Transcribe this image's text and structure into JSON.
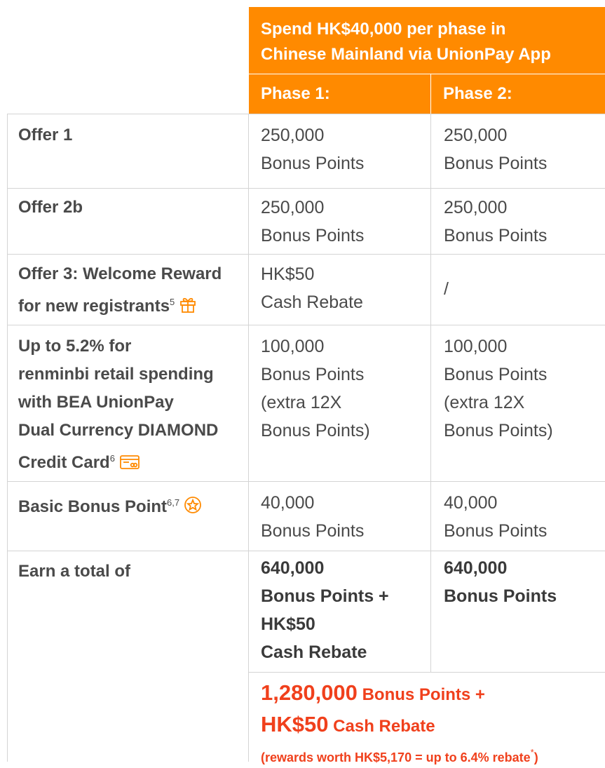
{
  "header": {
    "line1": "Spend HK$40,000 per phase in",
    "line2": "Chinese Mainland via UnionPay App",
    "phase1": "Phase 1:",
    "phase2": "Phase 2:"
  },
  "rows": [
    {
      "label": [
        "Offer 1"
      ],
      "p1": [
        "250,000",
        "Bonus Points"
      ],
      "p2": [
        "250,000",
        "Bonus Points"
      ]
    },
    {
      "label": [
        "Offer 2b"
      ],
      "p1": [
        "250,000",
        "Bonus Points"
      ],
      "p2": [
        "250,000",
        "Bonus Points"
      ]
    },
    {
      "label": [
        "Offer 3: Welcome Reward",
        "for new registrants"
      ],
      "sup": "5",
      "icon": "gift-icon",
      "p1": [
        "HK$50",
        "Cash Rebate"
      ],
      "p2": [
        "/"
      ]
    },
    {
      "label": [
        "Up to 5.2% for",
        "renminbi retail spending",
        "with BEA UnionPay",
        "Dual Currency DIAMOND",
        "Credit Card"
      ],
      "sup": "6",
      "icon": "credit-card-icon",
      "p1": [
        "100,000",
        "Bonus Points",
        "(extra 12X",
        "Bonus Points)"
      ],
      "p2": [
        "100,000",
        "Bonus Points",
        "(extra 12X",
        "Bonus Points)"
      ]
    },
    {
      "label": [
        "Basic Bonus Point"
      ],
      "sup": "6,7",
      "icon": "star-badge-icon",
      "p1": [
        "40,000",
        "Bonus Points"
      ],
      "p2": [
        "40,000",
        "Bonus Points"
      ]
    },
    {
      "label": [
        "Earn a total of"
      ],
      "p1": [
        "640,000",
        "Bonus Points +",
        "HK$50",
        "Cash Rebate"
      ],
      "p2": [
        "640,000",
        "Bonus Points"
      ]
    }
  ],
  "grand_total": {
    "points_value": "1,280,000",
    "points_label": " Bonus Points +",
    "cash_value": "HK$50",
    "cash_label": " Cash Rebate",
    "note": "(rewards worth HK$5,170 = up to 6.4% rebate",
    "note_mark": "*",
    "note_end": ")"
  },
  "colors": {
    "accent": "#ff8a00",
    "total_text": "#f0401c",
    "border": "#d4d4d4"
  }
}
